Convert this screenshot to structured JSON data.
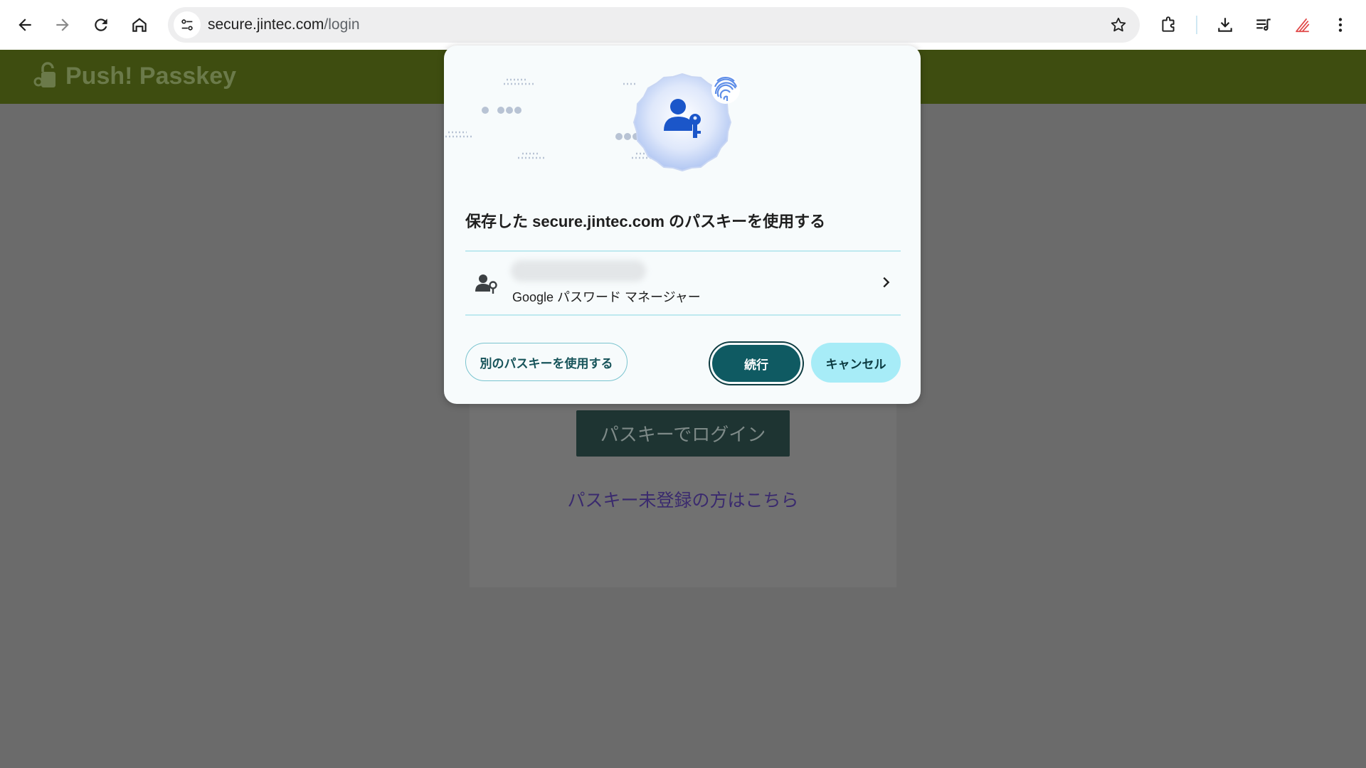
{
  "browser": {
    "url_host": "secure.jintec.com",
    "url_path": "/login",
    "toolbar_icons": [
      "back-icon",
      "forward-icon",
      "reload-icon",
      "home-icon",
      "site-settings-icon",
      "bookmark-star-icon",
      "extensions-icon",
      "downloads-icon",
      "reading-list-icon",
      "profile-extension-icon",
      "more-menu-icon"
    ]
  },
  "site": {
    "logo_text": "Push! Passkey",
    "login_button": "パスキーでログイン",
    "register_link": "パスキー未登録の方はこちら"
  },
  "dialog": {
    "title": "保存した secure.jintec.com のパスキーを使用する",
    "credential": {
      "name": "",
      "source": "Google パスワード マネージャー"
    },
    "buttons": {
      "other": "別のパスキーを使用する",
      "continue": "続行",
      "cancel": "キャンセル"
    }
  },
  "colors": {
    "site_header": "#3e4d10",
    "dialog_bg": "#f7fbfc",
    "continue_bg": "#0f5a62",
    "cancel_bg": "#a7ecf7",
    "divider": "#bfe9ef"
  }
}
